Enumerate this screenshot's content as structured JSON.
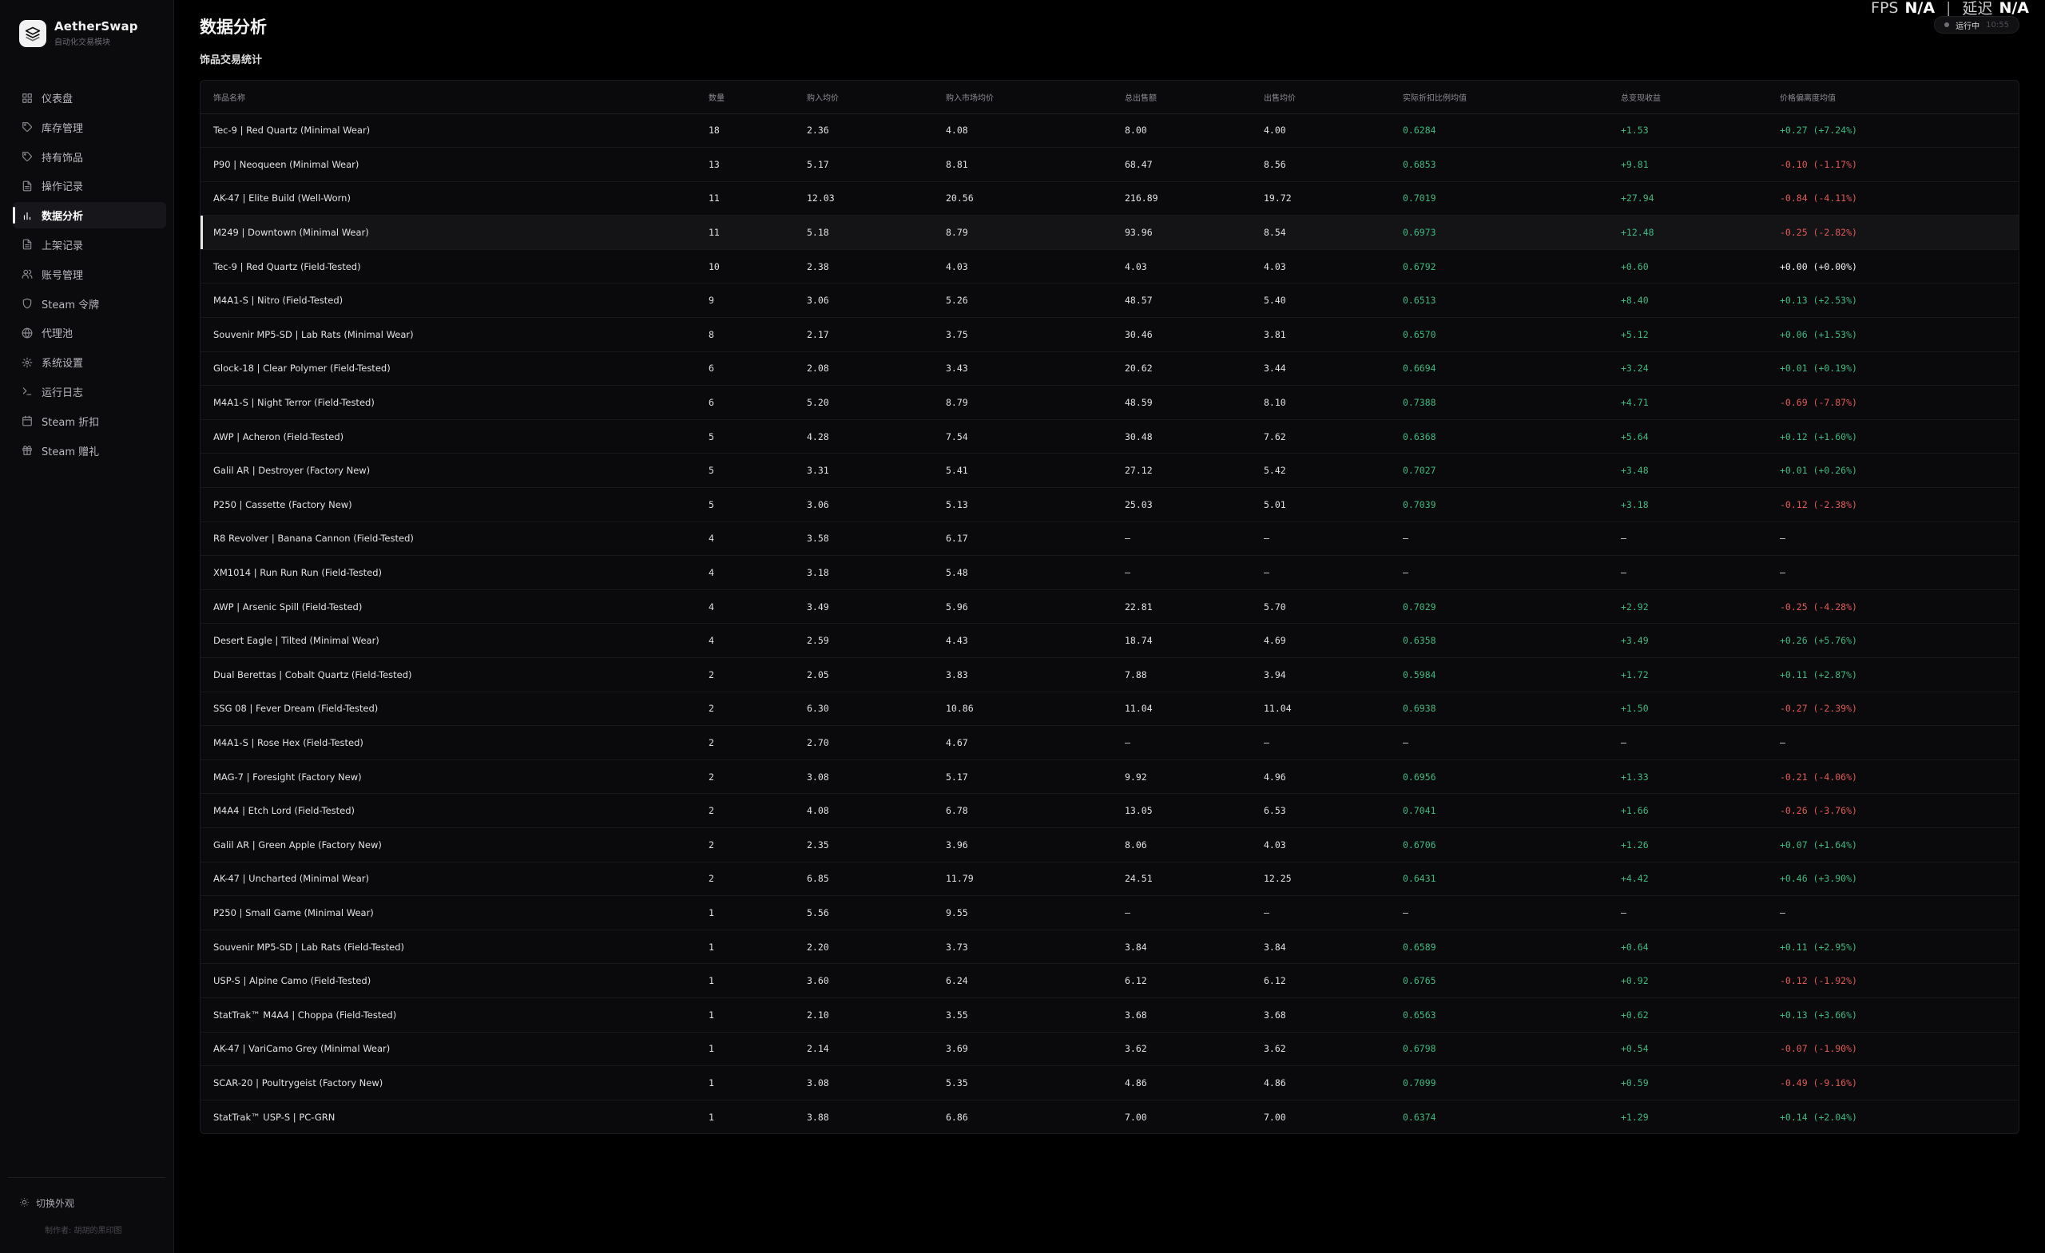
{
  "brand": {
    "name": "AetherSwap",
    "subtitle": "自动化交易模块"
  },
  "nav": [
    {
      "label": "仪表盘",
      "icon": "dashboard-icon"
    },
    {
      "label": "库存管理",
      "icon": "tag-icon"
    },
    {
      "label": "持有饰品",
      "icon": "tag-icon"
    },
    {
      "label": "操作记录",
      "icon": "document-icon"
    },
    {
      "label": "数据分析",
      "icon": "bar-chart-icon",
      "active": true
    },
    {
      "label": "上架记录",
      "icon": "document-icon"
    },
    {
      "label": "账号管理",
      "icon": "users-icon"
    },
    {
      "label": "Steam 令牌",
      "icon": "shield-icon"
    },
    {
      "label": "代理池",
      "icon": "globe-icon"
    },
    {
      "label": "系统设置",
      "icon": "gear-icon"
    },
    {
      "label": "运行日志",
      "icon": "terminal-icon"
    },
    {
      "label": "Steam 折扣",
      "icon": "calendar-icon"
    },
    {
      "label": "Steam 赠礼",
      "icon": "gift-icon"
    }
  ],
  "footer": {
    "theme_toggle": "切换外观",
    "credit": "制作者: 胡胡的黑印图"
  },
  "header": {
    "title": "数据分析",
    "section": "饰品交易统计",
    "fps_label": "FPS",
    "fps_value": "N/A",
    "latency_label": "延迟",
    "latency_value": "N/A",
    "status": "运行中",
    "status_time": "10:55"
  },
  "table": {
    "columns": [
      "饰品名称",
      "数量",
      "购入均价",
      "购入市场均价",
      "总出售额",
      "出售均价",
      "实际折扣比例均值",
      "总变现收益",
      "价格偏离度均值"
    ],
    "highlight_row": 3,
    "rows": [
      [
        "Tec-9 | Red Quartz (Minimal Wear)",
        "18",
        "2.36",
        "4.08",
        "8.00",
        "4.00",
        "0.6284",
        "+1.53",
        "+0.27 (+7.24%)"
      ],
      [
        "P90 | Neoqueen (Minimal Wear)",
        "13",
        "5.17",
        "8.81",
        "68.47",
        "8.56",
        "0.6853",
        "+9.81",
        "-0.10 (-1.17%)"
      ],
      [
        "AK-47 | Elite Build (Well-Worn)",
        "11",
        "12.03",
        "20.56",
        "216.89",
        "19.72",
        "0.7019",
        "+27.94",
        "-0.84 (-4.11%)"
      ],
      [
        "M249 | Downtown (Minimal Wear)",
        "11",
        "5.18",
        "8.79",
        "93.96",
        "8.54",
        "0.6973",
        "+12.48",
        "-0.25 (-2.82%)"
      ],
      [
        "Tec-9 | Red Quartz (Field-Tested)",
        "10",
        "2.38",
        "4.03",
        "4.03",
        "4.03",
        "0.6792",
        "+0.60",
        "+0.00 (+0.00%)"
      ],
      [
        "M4A1-S | Nitro (Field-Tested)",
        "9",
        "3.06",
        "5.26",
        "48.57",
        "5.40",
        "0.6513",
        "+8.40",
        "+0.13 (+2.53%)"
      ],
      [
        "Souvenir MP5-SD | Lab Rats (Minimal Wear)",
        "8",
        "2.17",
        "3.75",
        "30.46",
        "3.81",
        "0.6570",
        "+5.12",
        "+0.06 (+1.53%)"
      ],
      [
        "Glock-18 | Clear Polymer (Field-Tested)",
        "6",
        "2.08",
        "3.43",
        "20.62",
        "3.44",
        "0.6694",
        "+3.24",
        "+0.01 (+0.19%)"
      ],
      [
        "M4A1-S | Night Terror (Field-Tested)",
        "6",
        "5.20",
        "8.79",
        "48.59",
        "8.10",
        "0.7388",
        "+4.71",
        "-0.69 (-7.87%)"
      ],
      [
        "AWP | Acheron (Field-Tested)",
        "5",
        "4.28",
        "7.54",
        "30.48",
        "7.62",
        "0.6368",
        "+5.64",
        "+0.12 (+1.60%)"
      ],
      [
        "Galil AR | Destroyer (Factory New)",
        "5",
        "3.31",
        "5.41",
        "27.12",
        "5.42",
        "0.7027",
        "+3.48",
        "+0.01 (+0.26%)"
      ],
      [
        "P250 | Cassette (Factory New)",
        "5",
        "3.06",
        "5.13",
        "25.03",
        "5.01",
        "0.7039",
        "+3.18",
        "-0.12 (-2.38%)"
      ],
      [
        "R8 Revolver | Banana Cannon (Field-Tested)",
        "4",
        "3.58",
        "6.17",
        "—",
        "—",
        "—",
        "—",
        "—"
      ],
      [
        "XM1014 | Run Run Run (Field-Tested)",
        "4",
        "3.18",
        "5.48",
        "—",
        "—",
        "—",
        "—",
        "—"
      ],
      [
        "AWP | Arsenic Spill (Field-Tested)",
        "4",
        "3.49",
        "5.96",
        "22.81",
        "5.70",
        "0.7029",
        "+2.92",
        "-0.25 (-4.28%)"
      ],
      [
        "Desert Eagle | Tilted (Minimal Wear)",
        "4",
        "2.59",
        "4.43",
        "18.74",
        "4.69",
        "0.6358",
        "+3.49",
        "+0.26 (+5.76%)"
      ],
      [
        "Dual Berettas | Cobalt Quartz (Field-Tested)",
        "2",
        "2.05",
        "3.83",
        "7.88",
        "3.94",
        "0.5984",
        "+1.72",
        "+0.11 (+2.87%)"
      ],
      [
        "SSG 08 | Fever Dream (Field-Tested)",
        "2",
        "6.30",
        "10.86",
        "11.04",
        "11.04",
        "0.6938",
        "+1.50",
        "-0.27 (-2.39%)"
      ],
      [
        "M4A1-S | Rose Hex (Field-Tested)",
        "2",
        "2.70",
        "4.67",
        "—",
        "—",
        "—",
        "—",
        "—"
      ],
      [
        "MAG-7 | Foresight (Factory New)",
        "2",
        "3.08",
        "5.17",
        "9.92",
        "4.96",
        "0.6956",
        "+1.33",
        "-0.21 (-4.06%)"
      ],
      [
        "M4A4 | Etch Lord (Field-Tested)",
        "2",
        "4.08",
        "6.78",
        "13.05",
        "6.53",
        "0.7041",
        "+1.66",
        "-0.26 (-3.76%)"
      ],
      [
        "Galil AR | Green Apple (Factory New)",
        "2",
        "2.35",
        "3.96",
        "8.06",
        "4.03",
        "0.6706",
        "+1.26",
        "+0.07 (+1.64%)"
      ],
      [
        "AK-47 | Uncharted (Minimal Wear)",
        "2",
        "6.85",
        "11.79",
        "24.51",
        "12.25",
        "0.6431",
        "+4.42",
        "+0.46 (+3.90%)"
      ],
      [
        "P250 | Small Game (Minimal Wear)",
        "1",
        "5.56",
        "9.55",
        "—",
        "—",
        "—",
        "—",
        "—"
      ],
      [
        "Souvenir MP5-SD | Lab Rats (Field-Tested)",
        "1",
        "2.20",
        "3.73",
        "3.84",
        "3.84",
        "0.6589",
        "+0.64",
        "+0.11 (+2.95%)"
      ],
      [
        "USP-S | Alpine Camo (Field-Tested)",
        "1",
        "3.60",
        "6.24",
        "6.12",
        "6.12",
        "0.6765",
        "+0.92",
        "-0.12 (-1.92%)"
      ],
      [
        "StatTrak™ M4A4 | Choppa (Field-Tested)",
        "1",
        "2.10",
        "3.55",
        "3.68",
        "3.68",
        "0.6563",
        "+0.62",
        "+0.13 (+3.66%)"
      ],
      [
        "AK-47 | VariCamo Grey (Minimal Wear)",
        "1",
        "2.14",
        "3.69",
        "3.62",
        "3.62",
        "0.6798",
        "+0.54",
        "-0.07 (-1.90%)"
      ],
      [
        "SCAR-20 | Poultrygeist (Factory New)",
        "1",
        "3.08",
        "5.35",
        "4.86",
        "4.86",
        "0.7099",
        "+0.59",
        "-0.49 (-9.16%)"
      ],
      [
        "StatTrak™ USP-S | PC-GRN",
        "1",
        "3.88",
        "6.86",
        "7.00",
        "7.00",
        "0.6374",
        "+1.29",
        "+0.14 (+2.04%)"
      ]
    ]
  },
  "colors": {
    "positive": "#3fb980",
    "negative": "#e05a5a",
    "background": "#000000",
    "sidebar": "#0b0b0d"
  }
}
